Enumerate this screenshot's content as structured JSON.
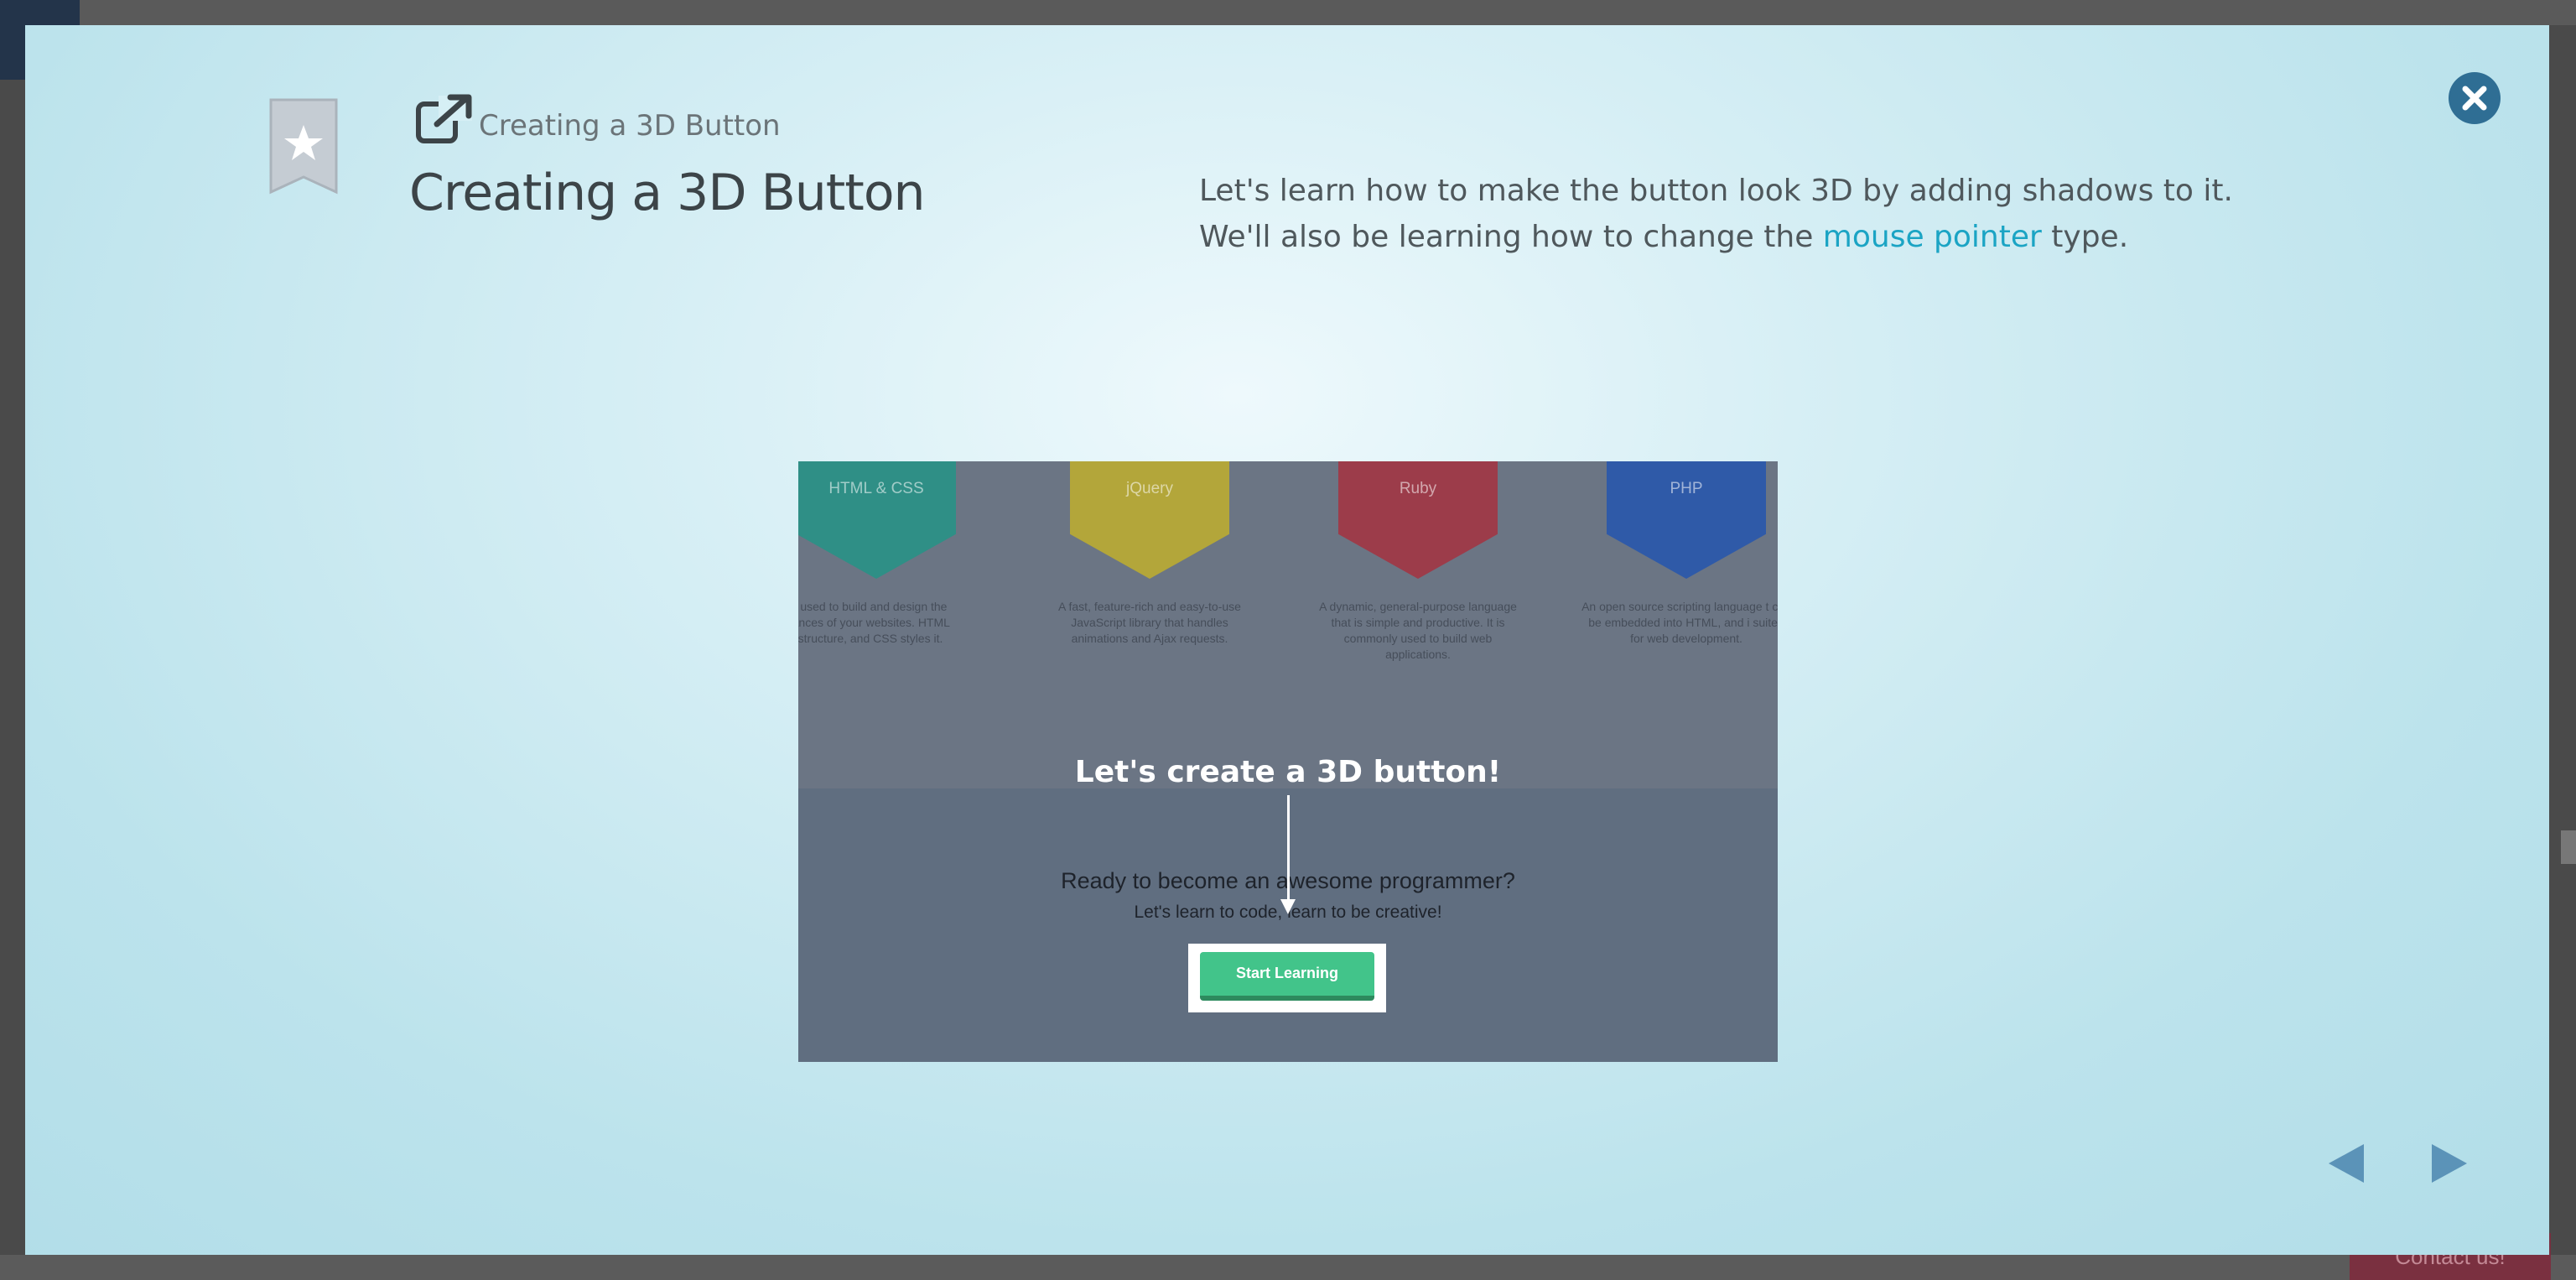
{
  "background": {
    "contact_label": "Contact us!"
  },
  "modal": {
    "breadcrumb": "Creating a 3D Button",
    "title": "Creating a 3D Button",
    "description": {
      "line1": "Let's learn how to make the button look 3D by adding shadows to it.",
      "line2_before": "We'll also be learning how to change the ",
      "line2_link": "mouse pointer",
      "line2_after": " type."
    }
  },
  "preview": {
    "badges": [
      {
        "label": "HTML & CSS",
        "color": "#2f8f86",
        "desc": "guages used to build and design the appearances of your websites. HTML ds the structure, and CSS styles it."
      },
      {
        "label": "jQuery",
        "color": "#b3a63a",
        "desc": "A fast, feature-rich and easy-to-use JavaScript library that handles animations and Ajax requests."
      },
      {
        "label": "Ruby",
        "color": "#9c3c4a",
        "desc": "A dynamic, general-purpose language that is simple and productive. It is commonly used to build web applications."
      },
      {
        "label": "PHP",
        "color": "#2f5aa8",
        "desc": "An open source scripting language t can be embedded into HTML, and i suited for web development."
      }
    ],
    "heading": "Let's create a 3D button!",
    "ready_text": "Ready to become an awesome programmer?",
    "ready_sub": "Let's learn to code, learn to be creative!",
    "start_label": "Start Learning"
  },
  "colors": {
    "accent": "#1ba4c4",
    "close": "#2f6e94",
    "nav": "#5b93b8"
  },
  "icons": {
    "bookmark": "bookmark-star-icon",
    "external": "external-link-icon",
    "close": "close-icon",
    "prev": "arrow-left-icon",
    "next": "arrow-right-icon"
  }
}
